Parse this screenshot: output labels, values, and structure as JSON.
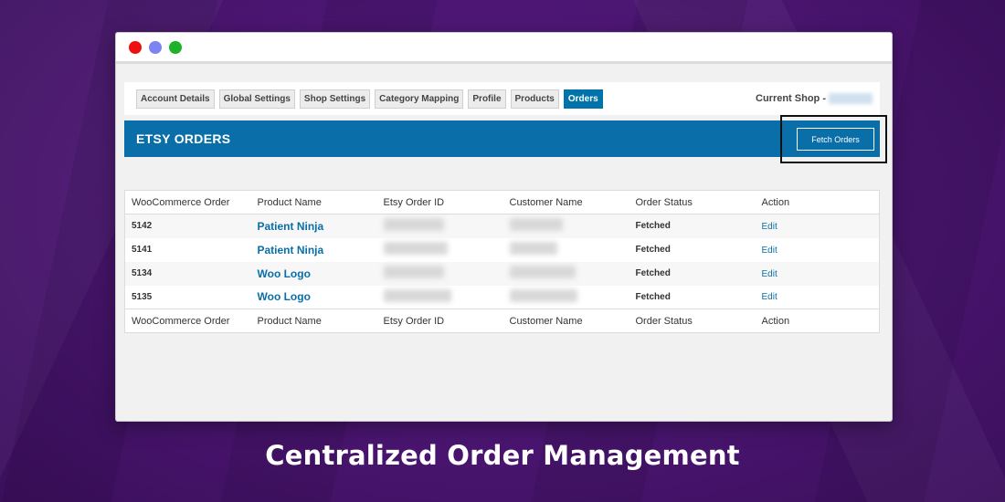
{
  "window": {
    "controls": [
      "close",
      "minimize",
      "maximize"
    ]
  },
  "tabs": [
    {
      "label": "Account Details",
      "active": false
    },
    {
      "label": "Global Settings",
      "active": false
    },
    {
      "label": "Shop Settings",
      "active": false
    },
    {
      "label": "Category Mapping",
      "active": false
    },
    {
      "label": "Profile",
      "active": false
    },
    {
      "label": "Products",
      "active": false
    },
    {
      "label": "Orders",
      "active": true
    }
  ],
  "current_shop": {
    "label": "Current Shop -"
  },
  "header": {
    "title": "ETSY ORDERS",
    "fetch_button": "Fetch Orders"
  },
  "table": {
    "columns": [
      "WooCommerce Order",
      "Product Name",
      "Etsy Order ID",
      "Customer Name",
      "Order Status",
      "Action"
    ],
    "rows": [
      {
        "order": "5142",
        "product": "Patient Ninja",
        "status": "Fetched",
        "action": "Edit"
      },
      {
        "order": "5141",
        "product": "Patient Ninja",
        "status": "Fetched",
        "action": "Edit"
      },
      {
        "order": "5134",
        "product": "Woo Logo",
        "status": "Fetched",
        "action": "Edit"
      },
      {
        "order": "5135",
        "product": "Woo Logo",
        "status": "Fetched",
        "action": "Edit"
      }
    ]
  },
  "caption": "Centralized Order Management",
  "colors": {
    "background": "#4a1570",
    "accent": "#0a6fa8",
    "active_tab": "#0073aa"
  }
}
